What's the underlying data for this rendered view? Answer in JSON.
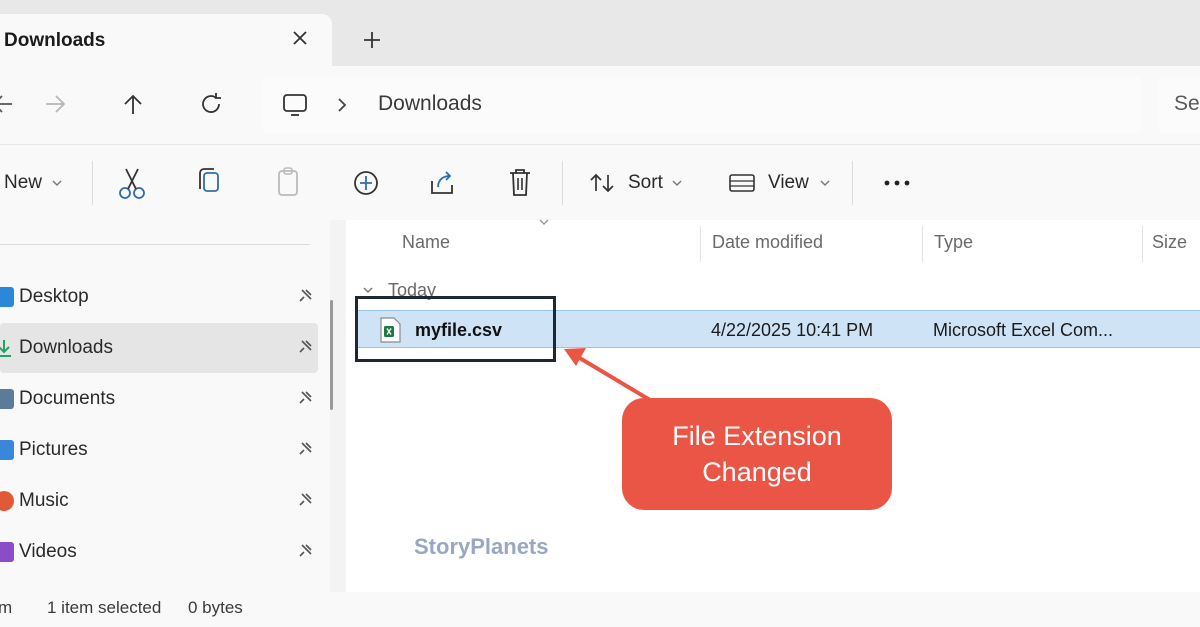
{
  "tab": {
    "title": "Downloads",
    "new_tab_icon": "plus-icon",
    "close_icon": "close-icon"
  },
  "address": {
    "location": "Downloads",
    "search_placeholder": "Se"
  },
  "commands": {
    "new_label": "New",
    "sort_label": "Sort",
    "view_label": "View"
  },
  "sidebar": {
    "items": [
      {
        "label": "Desktop",
        "color": "#2b88d8"
      },
      {
        "label": "Downloads",
        "color": "#21a366"
      },
      {
        "label": "Documents",
        "color": "#5c7a9a"
      },
      {
        "label": "Pictures",
        "color": "#3a86d8"
      },
      {
        "label": "Music",
        "color": "#e05a3a"
      },
      {
        "label": "Videos",
        "color": "#8a4cc8"
      }
    ]
  },
  "columns": {
    "name": "Name",
    "date": "Date modified",
    "type": "Type",
    "size": "Size"
  },
  "group": {
    "label": "Today"
  },
  "file": {
    "name": "myfile.csv",
    "date": "4/22/2025 10:41 PM",
    "type": "Microsoft Excel Com..."
  },
  "callout": {
    "line1": "File Extension",
    "line2": "Changed",
    "color": "#eb5545"
  },
  "watermark": "StoryPlanets",
  "status": {
    "count": "1 item selected",
    "size": "0 bytes",
    "prefix": "m"
  }
}
